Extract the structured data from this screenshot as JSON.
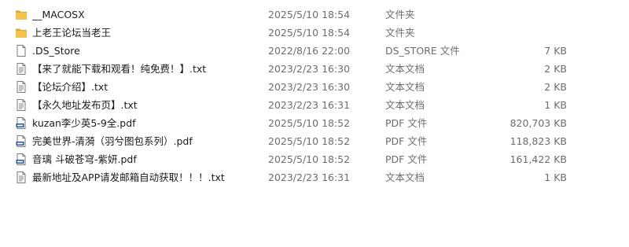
{
  "files": [
    {
      "name": "__MACOSX",
      "date": "2025/5/10 18:54",
      "type": "文件夹",
      "size": "",
      "icon": "folder-icon"
    },
    {
      "name": "上老王论坛当老王",
      "date": "2025/5/10 18:54",
      "type": "文件夹",
      "size": "",
      "icon": "folder-icon"
    },
    {
      "name": ".DS_Store",
      "date": "2022/8/16 22:00",
      "type": "DS_STORE 文件",
      "size": "7 KB",
      "icon": "blank-file-icon"
    },
    {
      "name": "【来了就能下载和观看！纯免费！】.txt",
      "date": "2023/2/23 16:30",
      "type": "文本文档",
      "size": "2 KB",
      "icon": "text-file-icon"
    },
    {
      "name": "【论坛介绍】.txt",
      "date": "2023/2/23 16:30",
      "type": "文本文档",
      "size": "2 KB",
      "icon": "text-file-icon"
    },
    {
      "name": "【永久地址发布页】.txt",
      "date": "2023/2/23 16:31",
      "type": "文本文档",
      "size": "1 KB",
      "icon": "text-file-icon"
    },
    {
      "name": "kuzan李少英5-9全.pdf",
      "date": "2025/5/10 18:52",
      "type": "PDF 文件",
      "size": "820,703 KB",
      "icon": "pdf-file-icon"
    },
    {
      "name": "完美世界-清漪（羽兮图包系列）.pdf",
      "date": "2025/5/10 18:52",
      "type": "PDF 文件",
      "size": "118,823 KB",
      "icon": "pdf-file-icon"
    },
    {
      "name": "音璃 斗破苍穹-紫妍.pdf",
      "date": "2025/5/10 18:52",
      "type": "PDF 文件",
      "size": "161,422 KB",
      "icon": "pdf-file-icon"
    },
    {
      "name": "最新地址及APP请发邮箱自动获取！！！.txt",
      "date": "2023/2/23 16:31",
      "type": "文本文档",
      "size": "1 KB",
      "icon": "text-file-icon"
    }
  ],
  "colors": {
    "folder": "#f2c14e",
    "folder_dark": "#dba63a",
    "pdf_badge": "#2b579a",
    "file_outline": "#7a7a7a"
  }
}
